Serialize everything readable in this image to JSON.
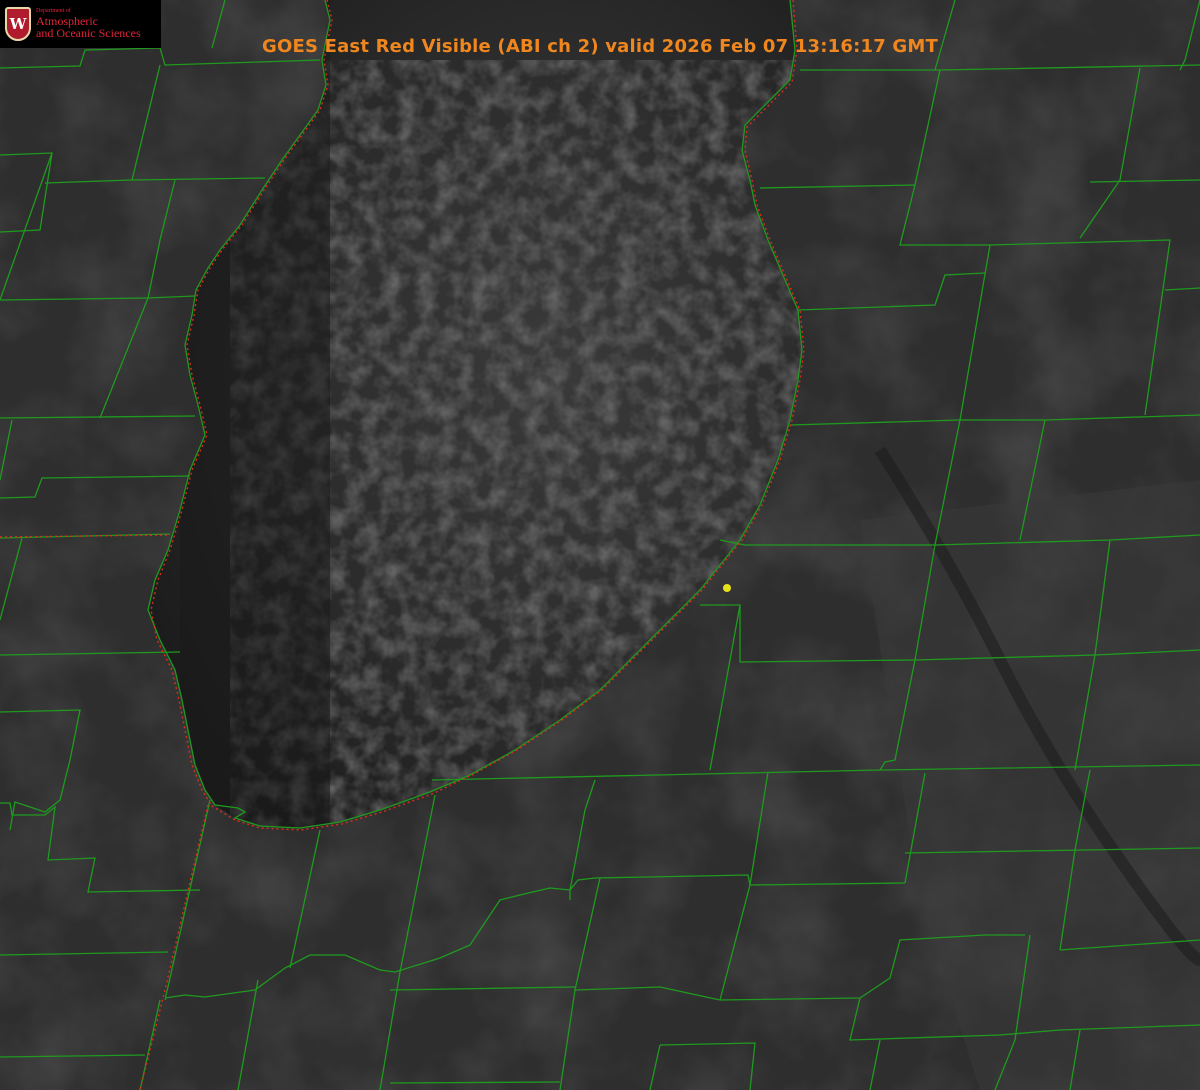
{
  "header": {
    "title": "GOES East Red Visible (ABI ch 2) valid 2026 Feb 07 13:16:17 GMT"
  },
  "logo": {
    "crest_letter": "W",
    "department": "Department of",
    "line1": "Atmospheric",
    "line2": "and Oceanic Sciences"
  },
  "map": {
    "county_line_color": "#1f9a1f",
    "state_line_color": "#e02b1c",
    "lake_color": "#1c1c1c",
    "land_color": "#2f2f2f",
    "marker_color": "#e6e01a"
  }
}
